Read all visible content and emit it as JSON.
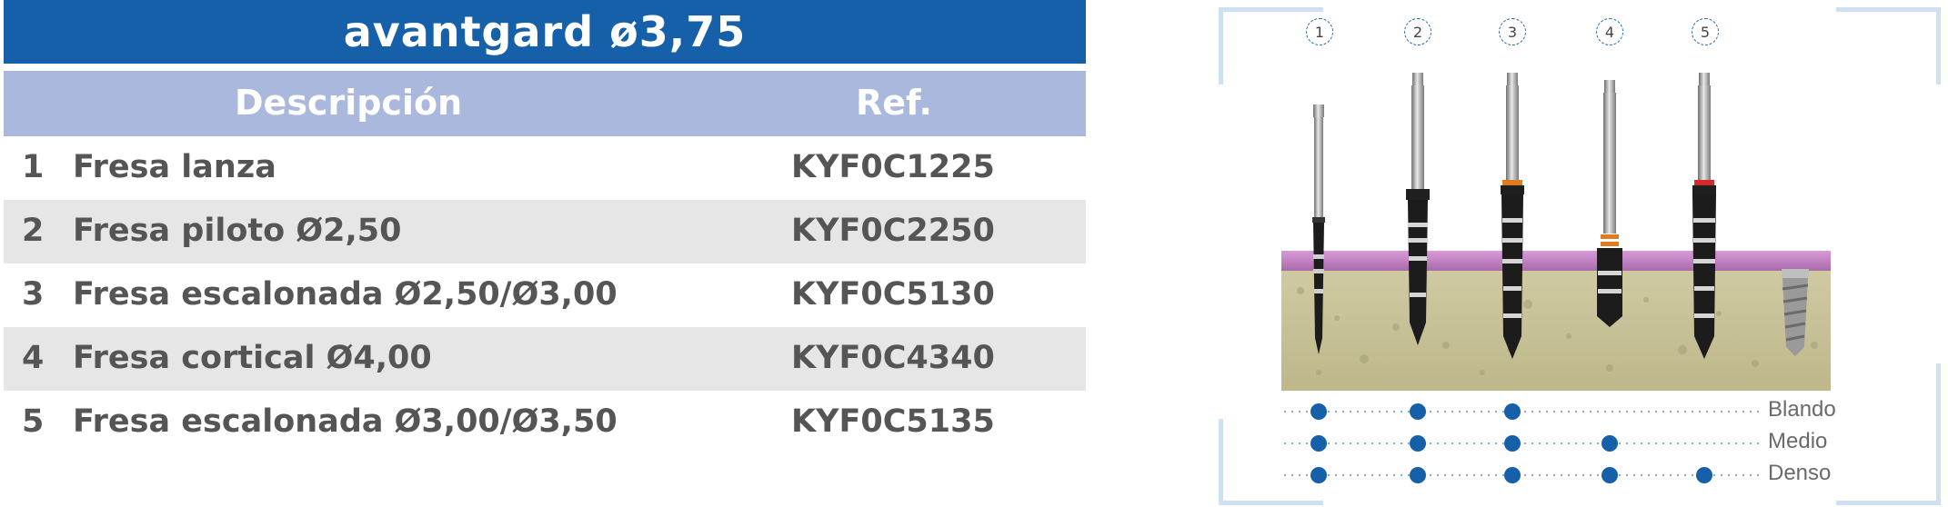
{
  "title": "avantgard ø3,75",
  "table": {
    "header": {
      "description": "Descripción",
      "ref": "Ref."
    },
    "rows": [
      {
        "num": "1",
        "description": "Fresa lanza",
        "ref": "KYF0C1225"
      },
      {
        "num": "2",
        "description": "Fresa piloto Ø2,50",
        "ref": "KYF0C2250"
      },
      {
        "num": "3",
        "description": "Fresa escalonada Ø2,50/Ø3,00",
        "ref": "KYF0C5130"
      },
      {
        "num": "4",
        "description": "Fresa cortical Ø4,00",
        "ref": "KYF0C4340"
      },
      {
        "num": "5",
        "description": "Fresa escalonada Ø3,00/Ø3,50",
        "ref": "KYF0C5135"
      }
    ]
  },
  "figure": {
    "drill_numbers": [
      "1",
      "2",
      "3",
      "4",
      "5"
    ],
    "density_rows": [
      {
        "label": "Blando",
        "drills": [
          1,
          2,
          3
        ]
      },
      {
        "label": "Medio",
        "drills": [
          1,
          2,
          3,
          4
        ]
      },
      {
        "label": "Denso",
        "drills": [
          1,
          2,
          3,
          4,
          5
        ]
      }
    ]
  },
  "colors": {
    "title_bg": "#1560a8",
    "header_bg": "#a9b8dc",
    "row_shade": "#e6e6e6",
    "text": "#555555",
    "dot": "#1560a8",
    "gum": "#c07cc0",
    "bone": "#c9c49a"
  }
}
